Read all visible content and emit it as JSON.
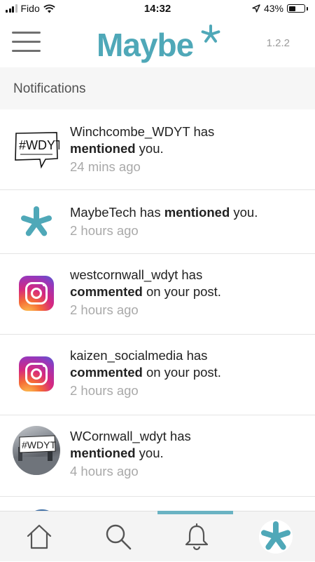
{
  "status": {
    "carrier": "Fido",
    "time": "14:32",
    "battery": "43%",
    "battery_level": 0.43
  },
  "header": {
    "logo_text": "Maybe",
    "version": "1.2.2"
  },
  "section": {
    "title": "Notifications"
  },
  "notifications": [
    {
      "user": "Winchcombe_WDYT",
      "pre": " has",
      "action": "mentioned",
      "post": " you.",
      "time": "24 mins ago",
      "avatar": "wdyt-sketch-logo"
    },
    {
      "user": "MaybeTech",
      "pre": " has ",
      "action": "mentioned",
      "post": " you.",
      "time": "2 hours ago",
      "avatar": "maybe-star-logo"
    },
    {
      "user": "westcornwall_wdyt",
      "pre": " has",
      "action": "commented",
      "post": " on your post.",
      "time": "2 hours ago",
      "avatar": "instagram-icon"
    },
    {
      "user": "kaizen_socialmedia",
      "pre": " has",
      "action": "commented",
      "post": " on your post.",
      "time": "2 hours ago",
      "avatar": "instagram-icon"
    },
    {
      "user": "WCornwall_wdyt",
      "pre": " has",
      "action": "mentioned",
      "post": " you.",
      "time": "4 hours ago",
      "avatar": "wdyt-photo-avatar"
    }
  ],
  "tabs": [
    {
      "name": "home",
      "icon": "home-icon"
    },
    {
      "name": "search",
      "icon": "search-icon"
    },
    {
      "name": "notifications",
      "icon": "bell-icon",
      "active": true
    },
    {
      "name": "maybe",
      "icon": "maybe-star-icon"
    }
  ],
  "colors": {
    "brand": "#4fa8b8",
    "active_tab": "#6ab3c3",
    "muted_text": "#a9a9a9"
  }
}
